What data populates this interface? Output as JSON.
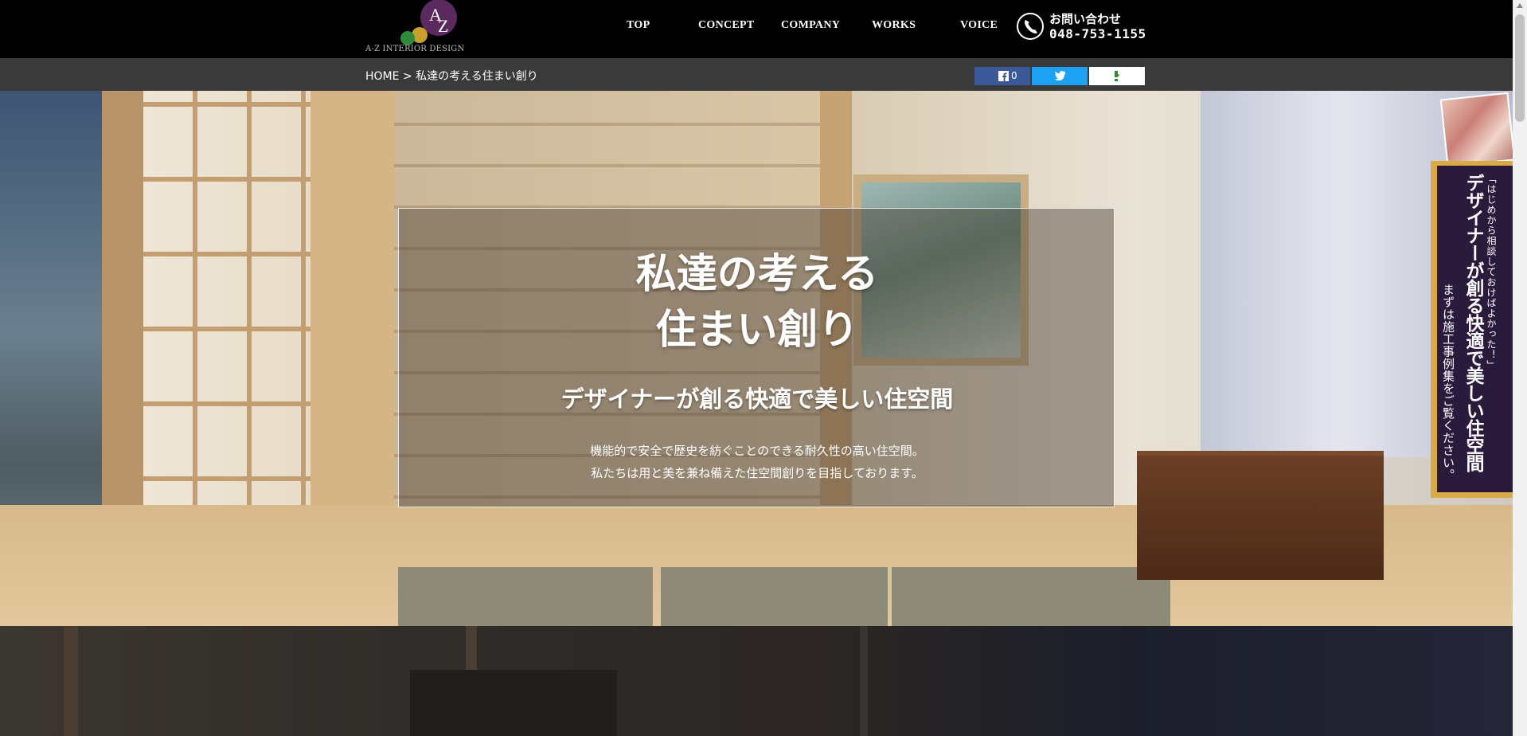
{
  "header": {
    "logo_text": "A-Z INTERIOR DESIGN",
    "nav": [
      {
        "label": "TOP"
      },
      {
        "label": "CONCEPT"
      },
      {
        "label": "COMPANY"
      },
      {
        "label": "WORKS"
      },
      {
        "label": "VOICE"
      }
    ],
    "contact": {
      "label": "お問い合わせ",
      "number": "048-753-1155",
      "icon": "phone-icon"
    }
  },
  "breadcrumb": {
    "home": "HOME",
    "separator": ">",
    "current": "私達の考える住まい創り"
  },
  "share": {
    "facebook_count": "0",
    "facebook_icon": "facebook-icon",
    "twitter_icon": "twitter-icon",
    "hatena_icon": "hatena-icon",
    "facebook_color": "#3b5998",
    "twitter_color": "#1da1f2"
  },
  "hero": {
    "title_line1": "私達の考える",
    "title_line2": "住まい創り",
    "subtitle": "デザイナーが創る快適で美しい住空間",
    "desc_line1": "機能的で安全で歴史を紡ぐことのできる耐久性の高い住空間。",
    "desc_line2": "私たちは用と美を兼ね備えた住空間創りを目指しております。"
  },
  "side_banner": {
    "line1": "「はじめから相談しておけばよかった！」",
    "line2": "デザイナーが創る快適で美しい住空間",
    "line3": "まずは施工事例集をご覧ください。",
    "accent_color": "#d9aa45",
    "background_color": "#2a1a3c"
  }
}
